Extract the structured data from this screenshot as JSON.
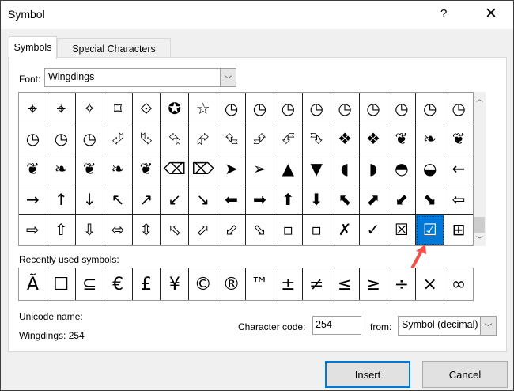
{
  "window": {
    "title": "Symbol",
    "help_label": "?",
    "close_label": "✕"
  },
  "tabs": [
    {
      "label": "Symbols",
      "active": true
    },
    {
      "label": "Special Characters",
      "active": false
    }
  ],
  "font": {
    "label": "Font:",
    "value": "Wingdings"
  },
  "symbols": [
    "⌖",
    "⌖",
    "✧",
    "⌑",
    "⟐",
    "✪",
    "☆",
    "◷",
    "◷",
    "◷",
    "◷",
    "◷",
    "◷",
    "◷",
    "◷",
    "◷",
    "◷",
    "◷",
    "◷",
    "⮰",
    "⮱",
    "⮲",
    "⮳",
    "⮴",
    "⮵",
    "⮶",
    "⮷",
    "❖",
    "❖",
    "❦",
    "❧",
    "❦",
    "❦",
    "❧",
    "❦",
    "❧",
    "❦",
    "⌫",
    "⌦",
    "➤",
    "➢",
    "▲",
    "▼",
    "◖",
    "◗",
    "◓",
    "◒",
    "←",
    "→",
    "↑",
    "↓",
    "↖",
    "↗",
    "↙",
    "↘",
    "⬅",
    "➡",
    "⬆",
    "⬇",
    "⬉",
    "⬈",
    "⬋",
    "⬊",
    "⇦",
    "⇨",
    "⇧",
    "⇩",
    "⬄",
    "⇳",
    "⬁",
    "⬀",
    "⬃",
    "⬂",
    "▫",
    "▫",
    "✗",
    "✓",
    "☒",
    "☑",
    "⊞"
  ],
  "selected_index": 78,
  "recent": {
    "label": "Recently used symbols:",
    "items": [
      "Ã",
      "☐",
      "⊆",
      "€",
      "£",
      "¥",
      "©",
      "®",
      "™",
      "±",
      "≠",
      "≤",
      "≥",
      "÷",
      "×",
      "∞"
    ]
  },
  "unicode_name": {
    "label": "Unicode name:",
    "value": "Wingdings: 254"
  },
  "character_code": {
    "label": "Character code:",
    "value": "254"
  },
  "from": {
    "label": "from:",
    "value": "Symbol (decimal)"
  },
  "buttons": {
    "insert": "Insert",
    "cancel": "Cancel"
  },
  "colors": {
    "selection": "#0078d7",
    "annotation_arrow": "#f2504b"
  }
}
